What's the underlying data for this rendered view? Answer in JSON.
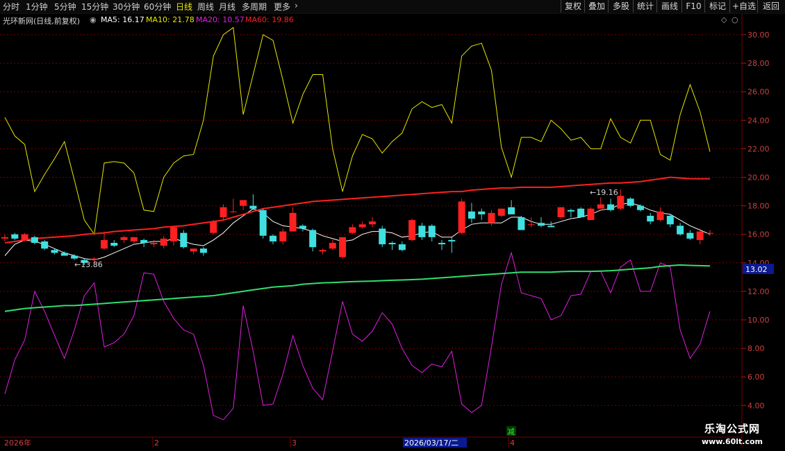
{
  "toolbar": {
    "tabs": [
      "分时",
      "1分钟",
      "5分钟",
      "15分钟",
      "30分钟",
      "60分钟",
      "日线",
      "周线",
      "月线",
      "多周期",
      "更多"
    ],
    "active_tab": "日线",
    "buttons": [
      "复权",
      "叠加",
      "多股",
      "统计",
      "画线",
      "F10",
      "标记",
      "+自选",
      "返回"
    ]
  },
  "header": {
    "stock_title": "光环新网(日线,前复权)",
    "ma5": "MA5: 16.17",
    "ma10": "MA10: 21.78",
    "ma20": "MA20: 10.57",
    "ma60": "MA60: 19.86"
  },
  "colors": {
    "ma5": "#ffffff",
    "ma10": "#e8e800",
    "ma20": "#e020e0",
    "ma60": "#ff2020",
    "up": "#ff2020",
    "down": "#40e0e0",
    "long_ma": "#30e070",
    "grid": "#7a0000"
  },
  "axis": {
    "ticks": [
      "30.00",
      "28.00",
      "26.00",
      "24.00",
      "22.00",
      "20.00",
      "18.00",
      "16.00",
      "14.00",
      "12.00",
      "10.00",
      "8.00",
      "6.00",
      "4.00"
    ],
    "current_price": "13.02"
  },
  "date_axis": {
    "labels": [
      "2026年",
      "2",
      "3",
      "2026/03/17/二",
      "4"
    ],
    "marker": "减"
  },
  "annotations": {
    "low": "←13.86",
    "high": "←19.16"
  },
  "watermark": {
    "title": "乐淘公式网",
    "url": "www.60lt.com"
  },
  "chart_data": {
    "type": "line",
    "title": "光环新网(日线,前复权)",
    "ylim": [
      3,
      31
    ],
    "ticks": [
      30,
      28,
      26,
      24,
      22,
      20,
      18,
      16,
      14,
      12,
      10,
      8,
      6,
      4
    ],
    "current_price": 13.02,
    "candles": [
      [
        15.7,
        16.0,
        15.5,
        15.8
      ],
      [
        16.0,
        16.1,
        15.6,
        15.7
      ],
      [
        15.6,
        16.1,
        15.5,
        16.0
      ],
      [
        15.8,
        15.9,
        15.3,
        15.4
      ],
      [
        15.5,
        15.6,
        14.9,
        15.0
      ],
      [
        14.9,
        15.0,
        14.6,
        14.7
      ],
      [
        14.7,
        14.8,
        14.5,
        14.5
      ],
      [
        14.5,
        14.6,
        14.2,
        14.3
      ],
      [
        14.2,
        14.3,
        13.86,
        14.0
      ],
      [
        14.2,
        14.4,
        14.0,
        14.3
      ],
      [
        15.0,
        16.2,
        14.9,
        15.6
      ],
      [
        15.4,
        15.6,
        15.1,
        15.2
      ],
      [
        15.6,
        15.9,
        15.4,
        15.8
      ],
      [
        15.5,
        15.8,
        15.3,
        15.8
      ],
      [
        15.6,
        15.7,
        15.1,
        15.4
      ],
      [
        15.3,
        15.6,
        15.1,
        15.4
      ],
      [
        15.2,
        15.9,
        15.0,
        15.7
      ],
      [
        15.5,
        16.6,
        15.2,
        16.5
      ],
      [
        16.1,
        16.3,
        15.0,
        15.1
      ],
      [
        14.8,
        14.9,
        14.6,
        15.0
      ],
      [
        15.0,
        15.1,
        14.5,
        14.7
      ],
      [
        16.1,
        17.0,
        16.0,
        16.9
      ],
      [
        17.2,
        18.1,
        17.0,
        17.9
      ],
      [
        17.6,
        18.5,
        17.5,
        17.6
      ],
      [
        18.0,
        18.4,
        17.7,
        18.4
      ],
      [
        18.0,
        18.8,
        17.7,
        17.8
      ],
      [
        17.7,
        17.8,
        15.7,
        15.9
      ],
      [
        15.9,
        16.0,
        15.3,
        15.5
      ],
      [
        15.5,
        16.4,
        15.3,
        16.2
      ],
      [
        16.2,
        17.9,
        16.2,
        17.5
      ],
      [
        16.6,
        16.7,
        16.2,
        16.4
      ],
      [
        16.3,
        16.4,
        14.8,
        15.1
      ],
      [
        14.8,
        15.0,
        14.6,
        14.9
      ],
      [
        15.0,
        15.6,
        14.9,
        15.4
      ],
      [
        14.4,
        14.5,
        14.3,
        15.8
      ],
      [
        16.1,
        16.7,
        16.0,
        16.5
      ],
      [
        16.5,
        16.9,
        16.4,
        16.7
      ],
      [
        16.7,
        17.2,
        16.5,
        16.9
      ],
      [
        16.4,
        16.6,
        15.1,
        15.3
      ],
      [
        15.4,
        15.5,
        14.9,
        15.3
      ],
      [
        15.3,
        15.5,
        14.8,
        14.9
      ],
      [
        15.6,
        17.1,
        15.5,
        17.0
      ],
      [
        16.6,
        16.8,
        15.6,
        15.8
      ],
      [
        16.6,
        16.7,
        15.5,
        15.8
      ],
      [
        15.4,
        15.6,
        14.9,
        15.3
      ],
      [
        15.6,
        15.8,
        14.7,
        15.5
      ],
      [
        16.1,
        18.5,
        16.0,
        18.3
      ],
      [
        17.6,
        18.2,
        16.8,
        17.1
      ],
      [
        17.6,
        17.8,
        17.0,
        17.4
      ],
      [
        16.8,
        17.7,
        16.6,
        17.5
      ],
      [
        17.3,
        17.8,
        17.2,
        17.8
      ],
      [
        17.9,
        18.4,
        17.4,
        17.4
      ],
      [
        17.2,
        17.3,
        16.6,
        16.3
      ],
      [
        16.7,
        17.2,
        16.5,
        16.7
      ],
      [
        16.8,
        17.2,
        16.5,
        16.6
      ],
      [
        16.6,
        16.9,
        16.5,
        16.5
      ],
      [
        17.2,
        17.9,
        17.1,
        17.9
      ],
      [
        17.7,
        17.8,
        17.2,
        17.6
      ],
      [
        17.8,
        17.9,
        17.2,
        17.2
      ],
      [
        17.0,
        17.9,
        17.2,
        17.8
      ],
      [
        17.8,
        18.6,
        17.8,
        18.1
      ],
      [
        18.1,
        18.5,
        17.6,
        17.7
      ],
      [
        17.8,
        19.16,
        17.7,
        18.7
      ],
      [
        18.5,
        18.6,
        17.9,
        18.0
      ],
      [
        18.0,
        18.1,
        17.6,
        17.7
      ],
      [
        17.3,
        17.5,
        16.7,
        16.9
      ],
      [
        17.0,
        17.9,
        16.9,
        17.6
      ],
      [
        17.3,
        17.4,
        16.5,
        16.7
      ],
      [
        16.6,
        16.8,
        15.9,
        16.0
      ],
      [
        16.1,
        16.3,
        15.6,
        15.7
      ],
      [
        15.6,
        16.4,
        15.3,
        16.2
      ],
      [
        16.1,
        16.3,
        15.9,
        16.1
      ]
    ],
    "series": [
      {
        "name": "MA5",
        "color": "#ffffff",
        "values": [
          14.5,
          15.3,
          15.6,
          15.5,
          15.3,
          15.0,
          14.7,
          14.5,
          14.3,
          14.2,
          14.4,
          14.7,
          15.0,
          15.3,
          15.4,
          15.5,
          15.5,
          15.7,
          15.5,
          15.3,
          15.2,
          15.6,
          16.1,
          16.8,
          17.3,
          17.8,
          17.5,
          16.9,
          16.6,
          16.5,
          16.4,
          16.2,
          15.9,
          15.7,
          15.5,
          15.6,
          16.0,
          16.2,
          16.2,
          16.1,
          15.8,
          15.9,
          16.1,
          16.2,
          15.8,
          15.8,
          16.3,
          16.7,
          16.8,
          16.8,
          16.8,
          17.2,
          17.2,
          16.9,
          16.7,
          16.7,
          16.9,
          17.1,
          17.2,
          17.4,
          17.7,
          17.8,
          18.1,
          18.2,
          18.0,
          17.7,
          17.5,
          17.4,
          17.0,
          16.6,
          16.3,
          16.0
        ]
      },
      {
        "name": "MA10",
        "color": "#e8e800",
        "values": [
          24.2,
          22.9,
          22.3,
          19.0,
          20.2,
          21.3,
          22.5,
          19.8,
          17.0,
          16.0,
          21.0,
          21.1,
          21.0,
          20.3,
          17.7,
          17.6,
          20.0,
          21.0,
          21.5,
          21.6,
          24.0,
          28.5,
          30.0,
          30.5,
          24.4,
          27.2,
          30.0,
          29.6,
          26.8,
          23.8,
          25.8,
          27.2,
          27.2,
          22.0,
          19.0,
          21.5,
          23.0,
          22.7,
          21.7,
          22.5,
          23.1,
          24.8,
          25.3,
          24.9,
          25.1,
          23.8,
          28.5,
          29.2,
          29.4,
          27.5,
          22.1,
          20.0,
          22.8,
          22.8,
          22.5,
          24.0,
          23.4,
          22.6,
          22.8,
          22.0,
          22.0,
          24.1,
          22.8,
          22.4,
          24.0,
          24.0,
          21.6,
          21.2,
          24.4,
          26.5,
          24.6,
          21.8
        ]
      },
      {
        "name": "MA20",
        "color": "#e020e0",
        "values": [
          4.8,
          7.2,
          8.6,
          12.0,
          10.6,
          8.9,
          7.3,
          9.3,
          11.7,
          12.6,
          8.1,
          8.4,
          9.0,
          10.3,
          13.3,
          13.2,
          11.3,
          10.1,
          9.3,
          9.0,
          6.8,
          3.3,
          3.0,
          3.8,
          11.0,
          7.8,
          4.0,
          4.1,
          6.2,
          8.9,
          6.8,
          5.2,
          4.4,
          7.8,
          11.3,
          9.0,
          8.5,
          9.2,
          10.5,
          9.7,
          8.0,
          6.8,
          6.3,
          6.9,
          6.7,
          7.8,
          4.1,
          3.5,
          4.0,
          8.1,
          12.5,
          14.7,
          11.9,
          11.7,
          11.5,
          10.0,
          10.3,
          11.7,
          11.8,
          13.4,
          13.4,
          11.9,
          13.7,
          14.2,
          12.0,
          12.0,
          14.0,
          13.7,
          9.3,
          7.3,
          8.3,
          10.6
        ]
      },
      {
        "name": "MA60",
        "color": "#ff2020",
        "values": [
          15.4,
          15.5,
          15.6,
          15.7,
          15.75,
          15.8,
          15.85,
          15.9,
          16.0,
          16.05,
          16.1,
          16.2,
          16.25,
          16.3,
          16.35,
          16.4,
          16.5,
          16.55,
          16.6,
          16.7,
          16.8,
          16.9,
          17.0,
          17.2,
          17.4,
          17.6,
          17.8,
          17.9,
          18.0,
          18.1,
          18.2,
          18.3,
          18.35,
          18.4,
          18.45,
          18.5,
          18.55,
          18.6,
          18.65,
          18.7,
          18.75,
          18.8,
          18.85,
          18.9,
          18.95,
          19.0,
          19.0,
          19.1,
          19.15,
          19.2,
          19.25,
          19.25,
          19.3,
          19.3,
          19.3,
          19.3,
          19.35,
          19.4,
          19.45,
          19.5,
          19.55,
          19.6,
          19.6,
          19.65,
          19.7,
          19.8,
          19.9,
          20.0,
          19.95,
          19.9,
          19.9,
          19.9
        ]
      },
      {
        "name": "",
        "color": "#30e070",
        "values": [
          10.6,
          10.7,
          10.8,
          10.85,
          10.9,
          10.95,
          11.0,
          11.0,
          11.05,
          11.1,
          11.15,
          11.2,
          11.25,
          11.3,
          11.35,
          11.4,
          11.45,
          11.5,
          11.55,
          11.6,
          11.65,
          11.7,
          11.8,
          11.9,
          12.0,
          12.1,
          12.2,
          12.3,
          12.35,
          12.4,
          12.5,
          12.55,
          12.6,
          12.62,
          12.65,
          12.68,
          12.7,
          12.72,
          12.75,
          12.78,
          12.8,
          12.82,
          12.85,
          12.9,
          12.95,
          13.0,
          13.05,
          13.1,
          13.15,
          13.2,
          13.25,
          13.3,
          13.35,
          13.35,
          13.35,
          13.35,
          13.38,
          13.4,
          13.4,
          13.4,
          13.42,
          13.45,
          13.5,
          13.55,
          13.6,
          13.65,
          13.75,
          13.8,
          13.85,
          13.82,
          13.8,
          13.78
        ]
      }
    ]
  }
}
